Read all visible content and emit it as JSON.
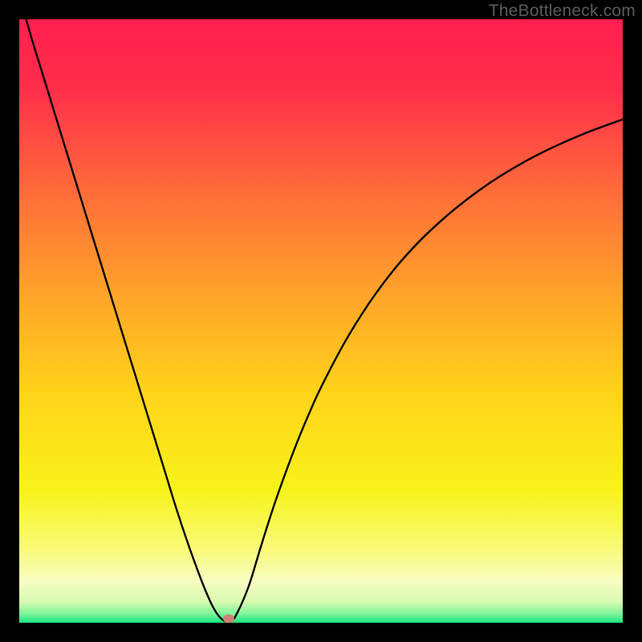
{
  "watermark": "TheBottleneck.com",
  "colors": {
    "frame": "#000000",
    "gradient_stops": [
      {
        "offset": 0.0,
        "color": "#ff1f4f"
      },
      {
        "offset": 0.12,
        "color": "#ff2f4a"
      },
      {
        "offset": 0.28,
        "color": "#ff6a3a"
      },
      {
        "offset": 0.45,
        "color": "#ffa22a"
      },
      {
        "offset": 0.62,
        "color": "#ffd31a"
      },
      {
        "offset": 0.78,
        "color": "#f7f31a"
      },
      {
        "offset": 0.88,
        "color": "#f9fb7a"
      },
      {
        "offset": 0.93,
        "color": "#f7fdc1"
      },
      {
        "offset": 0.965,
        "color": "#d9fbb2"
      },
      {
        "offset": 0.985,
        "color": "#7ef59a"
      },
      {
        "offset": 1.0,
        "color": "#18e67e"
      }
    ],
    "curve": "#000000",
    "marker": "#cf8478"
  },
  "chart_data": {
    "type": "line",
    "title": "",
    "xlabel": "",
    "ylabel": "",
    "xlim": [
      0,
      100
    ],
    "ylim": [
      0,
      100
    ],
    "series": [
      {
        "name": "bottleneck-curve",
        "x": [
          0,
          2,
          4,
          6,
          8,
          10,
          12,
          14,
          16,
          18,
          20,
          22,
          24,
          26,
          28,
          30,
          31,
          32,
          33,
          34,
          35,
          36,
          38,
          40,
          42,
          44,
          46,
          48,
          50,
          54,
          58,
          62,
          66,
          70,
          74,
          78,
          82,
          86,
          90,
          94,
          98,
          100
        ],
        "y": [
          104,
          97,
          90.5,
          84,
          77.5,
          71,
          64.5,
          58,
          51.5,
          45,
          38.5,
          32,
          25.5,
          19,
          13,
          7.5,
          5,
          2.8,
          1.2,
          0.3,
          0.2,
          1.4,
          6,
          12.5,
          18.8,
          24.5,
          29.8,
          34.6,
          39,
          46.6,
          53,
          58.4,
          62.9,
          66.7,
          70,
          72.9,
          75.4,
          77.6,
          79.5,
          81.2,
          82.7,
          83.4
        ]
      }
    ],
    "markers": [
      {
        "name": "optimal-point",
        "x": 34.7,
        "y": 0.6
      }
    ]
  }
}
